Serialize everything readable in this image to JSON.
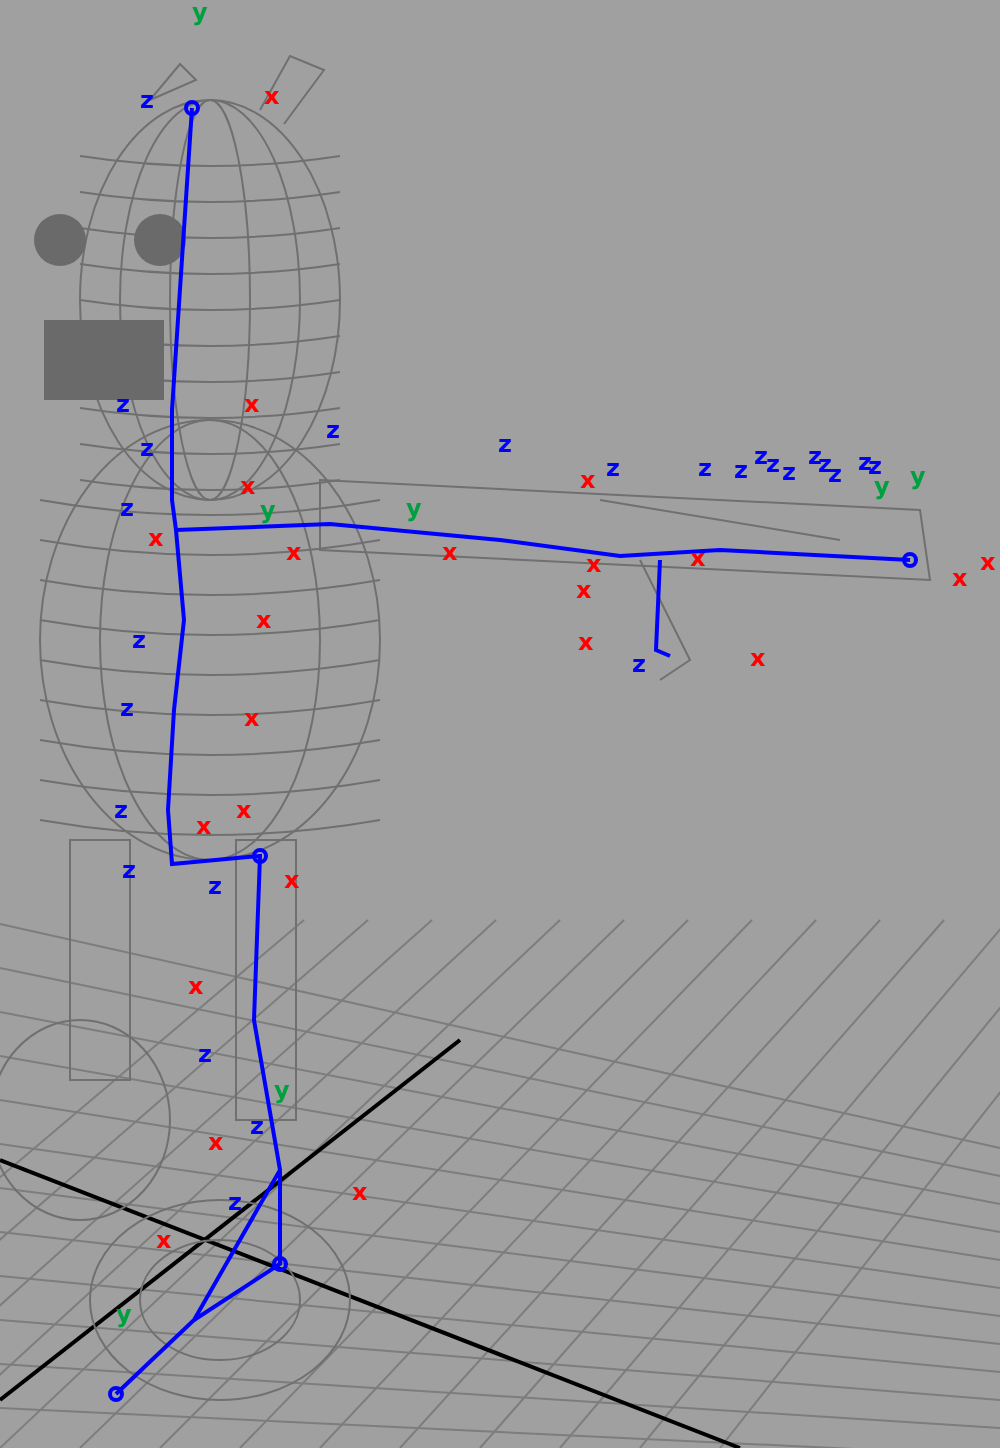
{
  "viewport": {
    "axis_labels": [
      {
        "text": "y",
        "color": "#00a040"
      },
      {
        "text": "z",
        "color": "#0000ff"
      },
      {
        "text": "x",
        "color": "#ff0000"
      },
      {
        "text": "z",
        "color": "#0000ff"
      },
      {
        "text": "x",
        "color": "#ff0000"
      },
      {
        "text": "z",
        "color": "#0000ff"
      },
      {
        "text": "z",
        "color": "#0000ff"
      },
      {
        "text": "z",
        "color": "#0000ff"
      },
      {
        "text": "x",
        "color": "#ff0000"
      },
      {
        "text": "x",
        "color": "#ff0000"
      },
      {
        "text": "y",
        "color": "#00a040"
      },
      {
        "text": "x",
        "color": "#ff0000"
      },
      {
        "text": "y",
        "color": "#00a040"
      },
      {
        "text": "x",
        "color": "#ff0000"
      },
      {
        "text": "z",
        "color": "#0000ff"
      },
      {
        "text": "x",
        "color": "#ff0000"
      },
      {
        "text": "z",
        "color": "#0000ff"
      },
      {
        "text": "x",
        "color": "#ff0000"
      },
      {
        "text": "z",
        "color": "#0000ff"
      },
      {
        "text": "x",
        "color": "#ff0000"
      },
      {
        "text": "x",
        "color": "#ff0000"
      },
      {
        "text": "z",
        "color": "#0000ff"
      },
      {
        "text": "z",
        "color": "#0000ff"
      },
      {
        "text": "x",
        "color": "#ff0000"
      },
      {
        "text": "z",
        "color": "#0000ff"
      },
      {
        "text": "z",
        "color": "#0000ff"
      },
      {
        "text": "z",
        "color": "#0000ff"
      },
      {
        "text": "z",
        "color": "#0000ff"
      },
      {
        "text": "z",
        "color": "#0000ff"
      },
      {
        "text": "z",
        "color": "#0000ff"
      },
      {
        "text": "z",
        "color": "#0000ff"
      },
      {
        "text": "z",
        "color": "#0000ff"
      },
      {
        "text": "z",
        "color": "#0000ff"
      },
      {
        "text": "y",
        "color": "#00a040"
      },
      {
        "text": "y",
        "color": "#00a040"
      },
      {
        "text": "x",
        "color": "#ff0000"
      },
      {
        "text": "x",
        "color": "#ff0000"
      },
      {
        "text": "x",
        "color": "#ff0000"
      },
      {
        "text": "z",
        "color": "#0000ff"
      },
      {
        "text": "x",
        "color": "#ff0000"
      },
      {
        "text": "x",
        "color": "#ff0000"
      },
      {
        "text": "x",
        "color": "#ff0000"
      },
      {
        "text": "z",
        "color": "#0000ff"
      },
      {
        "text": "z",
        "color": "#0000ff"
      },
      {
        "text": "x",
        "color": "#ff0000"
      },
      {
        "text": "x",
        "color": "#ff0000"
      },
      {
        "text": "z",
        "color": "#0000ff"
      },
      {
        "text": "x",
        "color": "#ff0000"
      },
      {
        "text": "z",
        "color": "#0000ff"
      },
      {
        "text": "z",
        "color": "#0000ff"
      },
      {
        "text": "x",
        "color": "#ff0000"
      },
      {
        "text": "y",
        "color": "#00a040"
      },
      {
        "text": "x",
        "color": "#ff0000"
      },
      {
        "text": "z",
        "color": "#0000ff"
      },
      {
        "text": "x",
        "color": "#ff0000"
      },
      {
        "text": "y",
        "color": "#00a040"
      }
    ]
  }
}
